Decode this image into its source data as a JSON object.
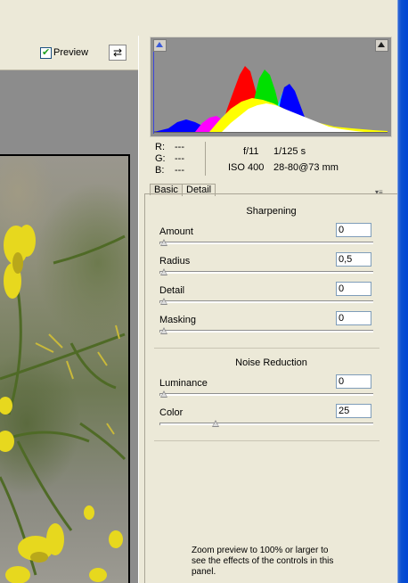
{
  "toolbar": {
    "preview_label": "Preview",
    "preview_checked": true
  },
  "histogram": {
    "colors": {
      "red": "#ff0000",
      "green": "#00e000",
      "blue": "#0000ff",
      "cyan": "#00e0ff",
      "magenta": "#ff00ff",
      "yellow": "#ffff00",
      "white": "#ffffff"
    }
  },
  "info": {
    "r_label": "R:",
    "r_value": "---",
    "g_label": "G:",
    "g_value": "---",
    "b_label": "B:",
    "b_value": "---",
    "aperture": "f/11",
    "shutter": "1/125 s",
    "iso": "ISO 400",
    "lens": "28-80@73 mm"
  },
  "tabs": [
    {
      "label": "Basic",
      "active": false
    },
    {
      "label": "Detail",
      "active": true
    }
  ],
  "sharpening": {
    "title": "Sharpening",
    "controls": [
      {
        "label": "Amount",
        "value": "0",
        "level": 0
      },
      {
        "label": "Radius",
        "value": "0,5",
        "level": 0
      },
      {
        "label": "Detail",
        "value": "0",
        "level": 0
      },
      {
        "label": "Masking",
        "value": "0",
        "level": 0
      }
    ]
  },
  "noise_reduction": {
    "title": "Noise Reduction",
    "controls": [
      {
        "label": "Luminance",
        "value": "0",
        "level": 0
      },
      {
        "label": "Color",
        "value": "25",
        "level": 0.25
      }
    ]
  },
  "note": "Zoom preview to 100% or larger to see the effects of the controls in this panel."
}
